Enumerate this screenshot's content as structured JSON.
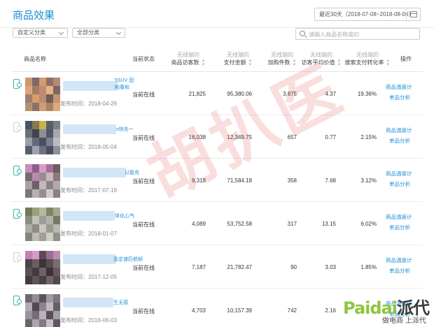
{
  "header": {
    "title": "商品效果",
    "date_range": "最近30天（2018-07-08~2018-08-06）"
  },
  "filters": {
    "custom_category": "自定义分类",
    "all_category": "全部分类",
    "search_placeholder": "请输入商品名称或ID"
  },
  "table": {
    "columns": {
      "name": "商品名称",
      "status": "当前状态",
      "note": "无线端的",
      "visitors": "商品访客数",
      "payment": "支付金额",
      "cart": "加购件数",
      "avg_value": "访客平均价值",
      "conversion": "搜索支付转化率",
      "ops": "操作"
    },
    "rows": [
      {
        "suffix": "5SUV 固粘春和",
        "published": "发布时间：2018-04-29",
        "status": "当前在线",
        "visitors": "21,825",
        "payment": "95,380.06",
        "cart": "3,875",
        "avg_value": "4.37",
        "conversion": "19.36%",
        "actions": [
          "商品温度计",
          "单品分析"
        ]
      },
      {
        "suffix": "s快充一",
        "published": "发布时间：2018-05-04",
        "status": "当前在线",
        "visitors": "16,038",
        "payment": "12,349.75",
        "cart": "657",
        "avg_value": "0.77",
        "conversion": "2.15%",
        "actions": [
          "商品温度计",
          "单品分析"
        ]
      },
      {
        "suffix": "以能充",
        "published": "发布时间：2017-07-19",
        "status": "当前在线",
        "visitors": "9,318",
        "payment": "71,584.18",
        "cart": "358",
        "avg_value": "7.68",
        "conversion": "3.12%",
        "actions": [
          "商品温度计",
          "单品分析"
        ]
      },
      {
        "suffix": "体化心气",
        "published": "发布时间：2018-01-07",
        "status": "当前在线",
        "visitors": "4,089",
        "payment": "53,752.58",
        "cart": "317",
        "avg_value": "13.15",
        "conversion": "6.02%",
        "actions": [
          "商品温度计",
          "单品分析"
        ]
      },
      {
        "suffix": "急定速匹航帧",
        "published": "发布时间：2017-12-05",
        "status": "当前在线",
        "visitors": "7,187",
        "payment": "21,782.47",
        "cart": "90",
        "avg_value": "3.03",
        "conversion": "1.85%",
        "actions": [
          "商品温度计",
          "单品分析"
        ]
      },
      {
        "suffix": "生无感",
        "published": "发布时间：2018-06-03",
        "status": "当前在线",
        "visitors": "4,703",
        "payment": "10,157.39",
        "cart": "742",
        "avg_value": "2.16",
        "conversion": "",
        "actions": [
          "商品温度计",
          "单品分析"
        ]
      }
    ]
  },
  "overlays": {
    "watermark": "胡扒医",
    "brand_logo_a": "Paidai",
    "brand_logo_b": "派代",
    "brand_slogan": "做电商 上派代"
  },
  "colors": {
    "accent": "#1a8fd6",
    "mobile_icon": "#3cb4a8",
    "watermark": "#e23c3c",
    "brand_green": "#8cc63f"
  }
}
